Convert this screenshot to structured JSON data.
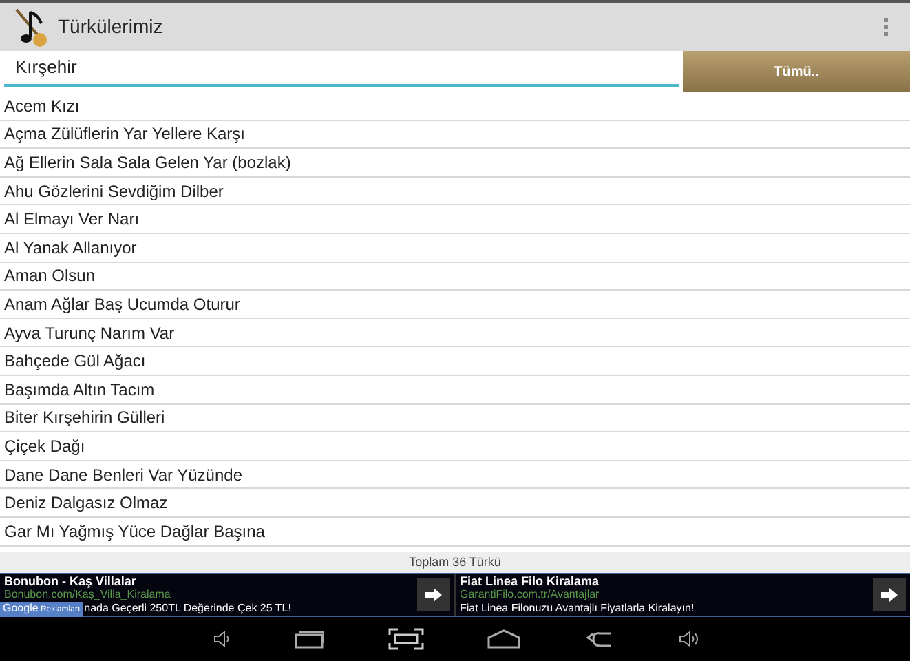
{
  "action_bar": {
    "title": "Türkülerimiz"
  },
  "search": {
    "value": "Kırşehir",
    "button": "Tümü.."
  },
  "songs": [
    "Acem Kızı",
    "Açma Zülüflerin Yar Yellere Karşı",
    "Ağ Ellerin Sala Sala Gelen Yar (bozlak)",
    "Ahu Gözlerini Sevdiğim Dilber",
    "Al Elmayı Ver Narı",
    "Al Yanak Allanıyor",
    "Aman Olsun",
    "Anam Ağlar Baş Ucumda Oturur",
    "Ayva Turunç Narım Var",
    "Bahçede Gül Ağacı",
    "Başımda Altın Tacım",
    "Biter Kırşehirin Gülleri",
    "Çiçek Dağı",
    "Dane Dane Benleri Var Yüzünde",
    "Deniz Dalgasız Olmaz",
    "Gar Mı Yağmış Yüce Dağlar Başına"
  ],
  "total": "Toplam 36 Türkü",
  "ads": [
    {
      "title": "Bonubon - Kaş Villalar",
      "url": "Bonubon.com/Kaş_Villa_Kiralama",
      "text": "nada Geçerli 250TL Değerinde Çek 25 TL!",
      "badge": [
        "Google",
        "Reklamları"
      ]
    },
    {
      "title": "Fiat Linea Filo Kiralama",
      "url": "GarantiFilo.com.tr/Avantajlar",
      "text": "Fiat Linea Filonuzu Avantajlı Fiyatlarla Kiralayın!"
    }
  ]
}
